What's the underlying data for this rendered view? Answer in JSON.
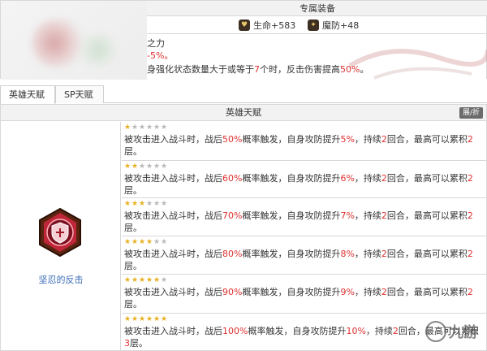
{
  "equipment": {
    "header": "专属装备",
    "stats": [
      {
        "icon": "heart-icon",
        "label": "生命+583"
      },
      {
        "icon": "magic-defense-icon",
        "label": "魔防+48"
      }
    ],
    "skill_name": "之力",
    "line1": "-5%。",
    "line2_parts": [
      "身强化状态数量大于或等于",
      "7",
      "个时，反击伤害提高",
      "50%",
      "。"
    ]
  },
  "tabs": [
    {
      "label": "英雄天赋",
      "active": true
    },
    {
      "label": "SP天赋",
      "active": false
    }
  ],
  "talent": {
    "header": "英雄天赋",
    "toggle_label": "展/折",
    "hero_name": "坚忍的反击",
    "rows": [
      {
        "stars": 1,
        "parts": [
          "被攻击进入战斗时，战后",
          "50%",
          "概率触发，自身攻防提升",
          "5%",
          "，持续",
          "2",
          "回合，最高可以累积",
          "2",
          "层。"
        ]
      },
      {
        "stars": 2,
        "parts": [
          "被攻击进入战斗时，战后",
          "60%",
          "概率触发，自身攻防提升",
          "6%",
          "，持续",
          "2",
          "回合，最高可以累积",
          "2",
          "层。"
        ]
      },
      {
        "stars": 3,
        "parts": [
          "被攻击进入战斗时，战后",
          "70%",
          "概率触发，自身攻防提升",
          "7%",
          "，持续",
          "2",
          "回合，最高可以累积",
          "2",
          "层。"
        ]
      },
      {
        "stars": 4,
        "parts": [
          "被攻击进入战斗时，战后",
          "80%",
          "概率触发，自身攻防提升",
          "8%",
          "，持续",
          "2",
          "回合，最高可以累积",
          "2",
          "层。"
        ]
      },
      {
        "stars": 5,
        "parts": [
          "被攻击进入战斗时，战后",
          "90%",
          "概率触发，自身攻防提升",
          "9%",
          "，持续",
          "2",
          "回合，最高可以累积",
          "2",
          "层。"
        ]
      },
      {
        "stars": 6,
        "parts": [
          "被攻击进入战斗时，战后",
          "100%",
          "概率触发，自身攻防提升",
          "10%",
          "，持续",
          "2",
          "回合，最高可以累积",
          "3",
          "层。"
        ]
      }
    ]
  },
  "watermark": {
    "text": "九游"
  },
  "colors": {
    "accent_red": "#e03030",
    "star_gold": "#e6b020",
    "link_blue": "#3a6ab8",
    "header_bg": "#f2f2f2"
  }
}
